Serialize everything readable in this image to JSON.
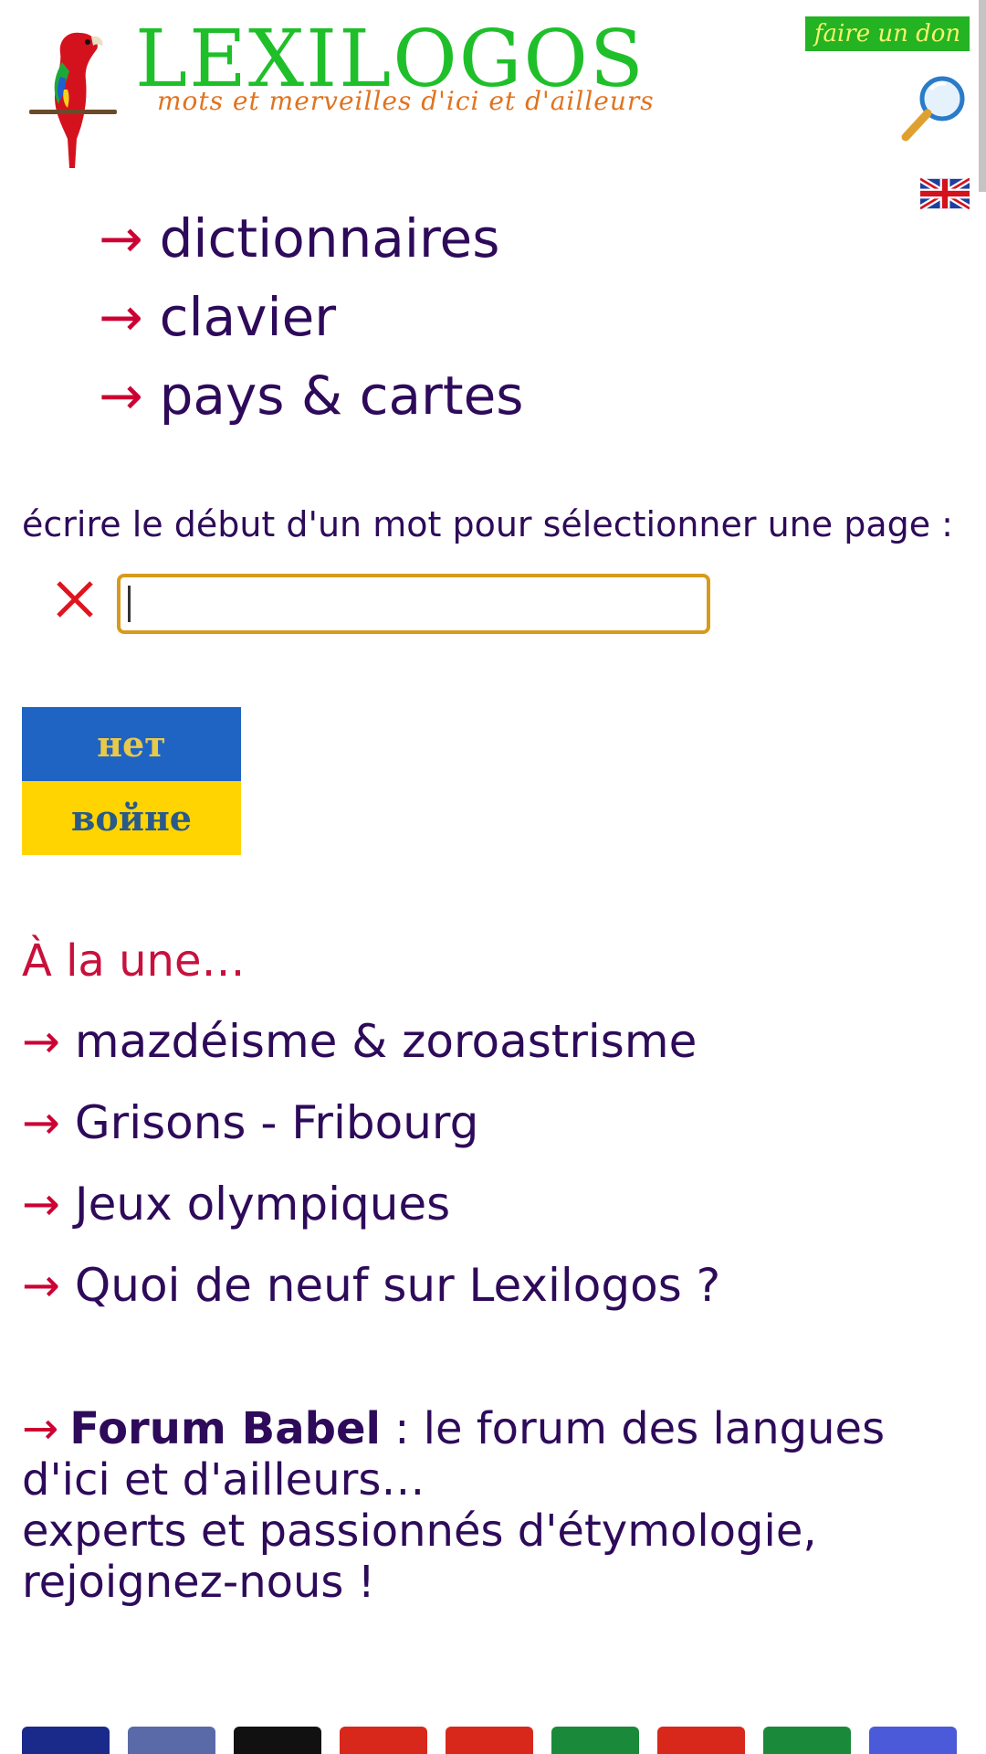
{
  "header": {
    "logo_text": "LEXILOGOS",
    "tagline": "mots et merveilles d'ici et d'ailleurs",
    "donate_label": "faire un don"
  },
  "main_nav": [
    {
      "label": "dictionnaires"
    },
    {
      "label": "clavier"
    },
    {
      "label": "pays & cartes"
    }
  ],
  "arrow_glyph": "→",
  "search": {
    "label": "écrire le début d'un mot pour sélectionner une page :",
    "value": "",
    "placeholder": ""
  },
  "ukraine_banner": {
    "top_text": "нет",
    "bottom_text": "войне"
  },
  "news": {
    "heading": "À la une…",
    "items": [
      {
        "label": "mazdéisme & zoroastrisme"
      },
      {
        "label": "Grisons - Fribourg"
      },
      {
        "label": "Jeux olympiques"
      },
      {
        "label": "Quoi de neuf sur Lexilogos ?"
      }
    ]
  },
  "forum": {
    "link_label": "Forum Babel",
    "description": " : le forum des langues d'ici et d'ailleurs…",
    "line2": "experts et passionnés d'étymologie, rejoignez-nous !"
  },
  "colors": {
    "link": "#2e0a5a",
    "arrow": "#cc0033",
    "heading_red": "#c8103c",
    "input_border": "#d89a1c",
    "logo_green": "#1fbf2a",
    "donate_bg": "#23b323"
  },
  "flag_strip_colors": [
    "#1a2a8a",
    "#5a6aa8",
    "#111111",
    "#d8281c",
    "#d8281c",
    "#1a8a3a",
    "#d8281c",
    "#1a8a3a",
    "#4a5ad8"
  ]
}
